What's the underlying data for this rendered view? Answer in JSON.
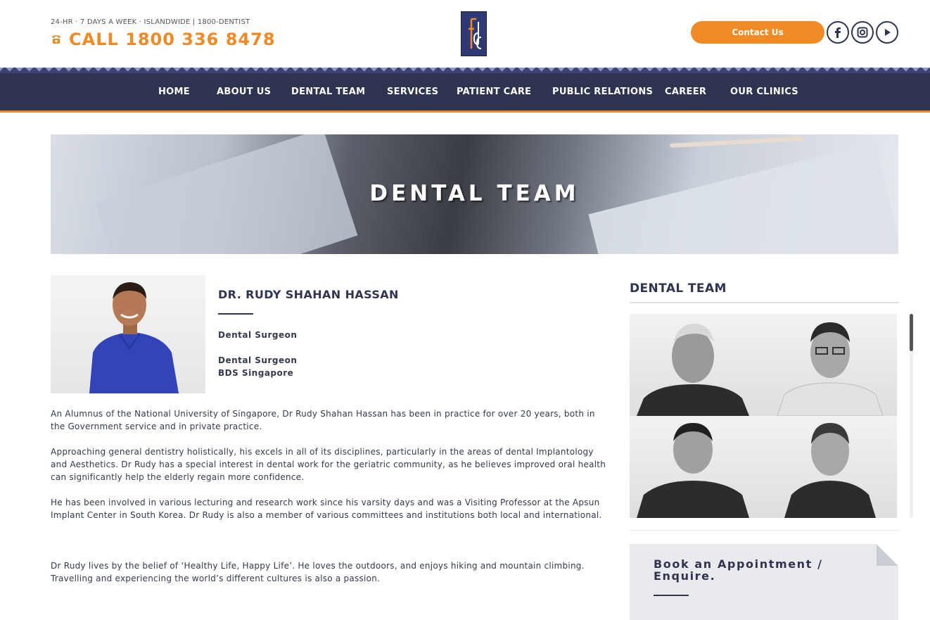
{
  "header": {
    "tagline": "24-HR · 7 DAYS A WEEK · ISLANDWIDE | 1800-DENTIST",
    "call": "CALL 1800 336 8478",
    "contact_button": "Contact Us",
    "social": [
      "facebook-icon",
      "instagram-icon",
      "youtube-icon"
    ]
  },
  "nav": {
    "items": [
      "HOME",
      "ABOUT US",
      "DENTAL TEAM",
      "SERVICES",
      "PATIENT CARE",
      "PUBLIC RELATIONS",
      "CAREER",
      "OUR CLINICS"
    ]
  },
  "hero": {
    "title": "DENTAL TEAM"
  },
  "profile": {
    "name": "DR. RUDY SHAHAN HASSAN",
    "role": "Dental Surgeon",
    "role2": "Dental Surgeon",
    "qualification": "BDS Singapore",
    "paragraphs": [
      "An Alumnus of the National University of Singapore, Dr Rudy Shahan Hassan has been in practice for over 20 years, both in the Government service and in private practice.",
      "Approaching general dentistry holistically, his excels in all of its disciplines, particularly in the areas of dental Implantology and Aesthetics. Dr Rudy has a special interest in dental work for the geriatric community, as he believes improved oral health can significantly help the elderly regain more confidence.",
      "He has been involved in various lecturing and research work since his varsity days and was a Visiting Professor at the Apsun Implant Center in South Korea. Dr Rudy is also a member of various committees and institutions both local and international.",
      "Dr Rudy lives by the belief of ‘Healthy Life, Happy Life’.  He loves the outdoors, and enjoys hiking and mountain climbing. Travelling and experiencing the world’s different cultures is also a passion."
    ]
  },
  "sidebar": {
    "title": "DENTAL TEAM",
    "book_title": "Book an Appointment / Enquire."
  },
  "colors": {
    "accent": "#f08a24",
    "navy": "#2e3350"
  }
}
